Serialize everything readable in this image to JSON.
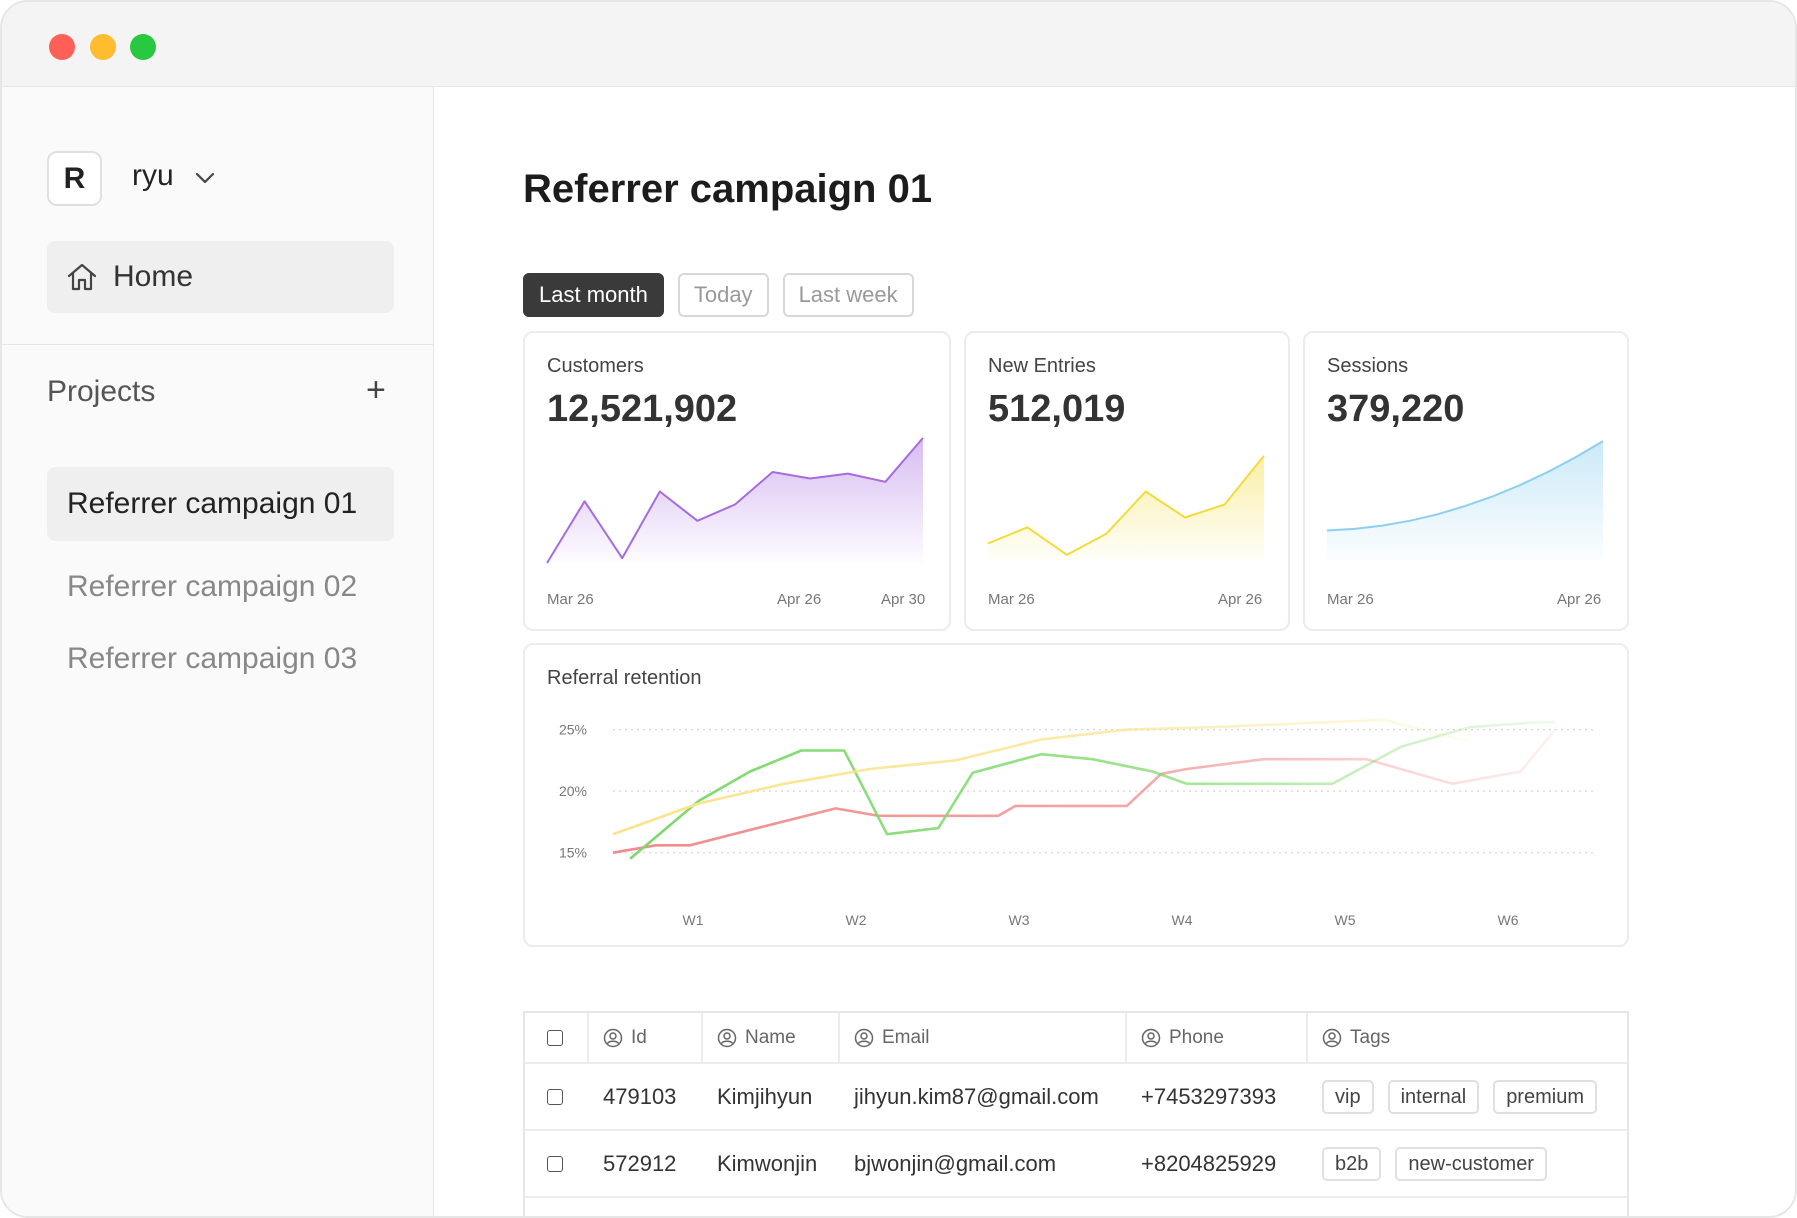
{
  "sidebar": {
    "workspace_initial": "R",
    "workspace_name": "ryu",
    "home_label": "Home",
    "projects_label": "Projects",
    "add_label": "+",
    "projects": [
      {
        "label": "Referrer campaign 01"
      },
      {
        "label": "Referrer campaign 02"
      },
      {
        "label": "Referrer campaign 03"
      }
    ]
  },
  "main": {
    "title": "Referrer campaign 01",
    "tabs": [
      {
        "label": "Last month"
      },
      {
        "label": "Today"
      },
      {
        "label": "Last week"
      }
    ],
    "stats": [
      {
        "label": "Customers",
        "value": "12,521,902",
        "ticks": [
          "Mar 26",
          "Apr 26",
          "Apr 30"
        ]
      },
      {
        "label": "New Entries",
        "value": "512,019",
        "ticks": [
          "Mar 26",
          "Apr 26"
        ]
      },
      {
        "label": "Sessions",
        "value": "379,220",
        "ticks": [
          "Mar 26",
          "Apr 26"
        ]
      }
    ],
    "table": {
      "headers": {
        "id": "Id",
        "name": "Name",
        "email": "Email",
        "phone": "Phone",
        "tags": "Tags"
      },
      "rows": [
        {
          "id": "479103",
          "name": "Kimjihyun",
          "email": "jihyun.kim87@gmail.com",
          "phone": "+7453297393",
          "tags": [
            "vip",
            "internal",
            "premium"
          ]
        },
        {
          "id": "572912",
          "name": "Kimwonjin",
          "email": "bjwonjin@gmail.com",
          "phone": "+8204825929",
          "tags": [
            "b2b",
            "new-customer"
          ]
        }
      ]
    }
  },
  "chart_data": [
    {
      "type": "area",
      "title": "Customers",
      "color": "#a66be0",
      "x": [
        0,
        1,
        2,
        3,
        4,
        5,
        6,
        7,
        8,
        9,
        10
      ],
      "values": [
        0,
        3.8,
        0.3,
        4.4,
        2.6,
        3.6,
        5.6,
        5.2,
        5.5,
        5.0,
        7.7
      ],
      "ylim": [
        0,
        8
      ]
    },
    {
      "type": "area",
      "title": "New Entries",
      "color": "#f2dc3c",
      "x": [
        0,
        1,
        2,
        3,
        4,
        5,
        6,
        7
      ],
      "values": [
        1.2,
        2.2,
        0.5,
        1.8,
        4.4,
        2.8,
        3.6,
        6.6
      ],
      "ylim": [
        0,
        8
      ]
    },
    {
      "type": "area",
      "title": "Sessions",
      "color": "#8ccff0",
      "x": [
        0,
        1,
        2,
        3,
        4,
        5,
        6,
        7,
        8,
        9,
        10
      ],
      "values": [
        2.0,
        2.1,
        2.3,
        2.6,
        3.0,
        3.5,
        4.1,
        4.8,
        5.6,
        6.5,
        7.5
      ],
      "ylim": [
        0,
        8
      ]
    },
    {
      "type": "line",
      "title": "Referral retention",
      "categories": [
        "W1",
        "W2",
        "W3",
        "W4",
        "W5",
        "W6"
      ],
      "yticks": [
        "15%",
        "20%",
        "25%"
      ],
      "ylim": [
        14,
        27
      ],
      "series": [
        {
          "color": "#f08a8a",
          "x": [
            0.0,
            0.25,
            0.45,
            0.9,
            1.3,
            1.55,
            2.0,
            2.25,
            2.35,
            2.6,
            3.0,
            3.2,
            3.35,
            3.8,
            4.0,
            4.4,
            4.9,
            5.3,
            5.5
          ],
          "values": [
            15,
            15.6,
            15.6,
            17.2,
            18.6,
            18.0,
            18.0,
            18.0,
            18.8,
            18.8,
            18.8,
            21.4,
            21.8,
            22.6,
            22.6,
            22.6,
            20.6,
            21.6,
            25.0
          ]
        },
        {
          "color": "#7ad968",
          "x": [
            0.1,
            0.5,
            0.8,
            1.1,
            1.35,
            1.6,
            1.9,
            2.1,
            2.5,
            2.8,
            3.15,
            3.35,
            3.8,
            4.2,
            4.6,
            5.0,
            5.4,
            5.5
          ],
          "values": [
            14.5,
            19.2,
            21.6,
            23.3,
            23.3,
            16.5,
            17.0,
            21.5,
            23.0,
            22.6,
            21.6,
            20.6,
            20.6,
            20.6,
            23.6,
            25.2,
            25.6,
            25.6
          ]
        },
        {
          "color": "#fae38a",
          "x": [
            0.0,
            0.5,
            1.0,
            1.5,
            2.0,
            2.5,
            3.0,
            3.5,
            4.0,
            4.5,
            5.0
          ],
          "values": [
            16.5,
            19.0,
            20.6,
            21.8,
            22.5,
            24.2,
            25.0,
            25.2,
            25.5,
            25.8,
            24.0
          ]
        }
      ]
    }
  ]
}
